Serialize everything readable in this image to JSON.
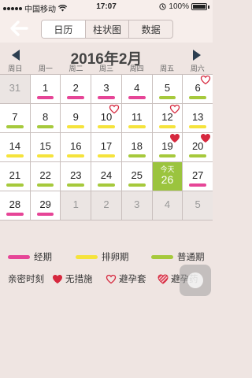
{
  "status": {
    "carrier": "中国移动",
    "time": "17:07",
    "battery": "100%"
  },
  "nav": {
    "tabs": [
      "日历",
      "柱状图",
      "数据"
    ],
    "active_tab": 0
  },
  "calendar": {
    "title": "2016年2月",
    "weekdays": [
      "周日",
      "周一",
      "周二",
      "周三",
      "周四",
      "周五",
      "周六"
    ],
    "today_label": "今天",
    "weeks": [
      [
        {
          "day": "31",
          "other": true
        },
        {
          "day": "1",
          "bar": "period"
        },
        {
          "day": "2",
          "bar": "period"
        },
        {
          "day": "3",
          "bar": "period"
        },
        {
          "day": "4",
          "bar": "period"
        },
        {
          "day": "5",
          "bar": "normal"
        },
        {
          "day": "6",
          "bar": "normal",
          "heart": "outline"
        }
      ],
      [
        {
          "day": "7",
          "bar": "normal"
        },
        {
          "day": "8",
          "bar": "normal"
        },
        {
          "day": "9",
          "bar": "ovulation"
        },
        {
          "day": "10",
          "bar": "ovulation",
          "heart": "outline"
        },
        {
          "day": "11",
          "bar": "ovulation"
        },
        {
          "day": "12",
          "bar": "ovulation",
          "heart": "outline"
        },
        {
          "day": "13",
          "bar": "ovulation"
        }
      ],
      [
        {
          "day": "14",
          "bar": "ovulation"
        },
        {
          "day": "15",
          "bar": "ovulation"
        },
        {
          "day": "16",
          "bar": "ovulation"
        },
        {
          "day": "17",
          "bar": "ovulation"
        },
        {
          "day": "18",
          "bar": "normal"
        },
        {
          "day": "19",
          "bar": "normal",
          "heart": "filled"
        },
        {
          "day": "20",
          "bar": "normal",
          "heart": "filled"
        }
      ],
      [
        {
          "day": "21",
          "bar": "normal"
        },
        {
          "day": "22",
          "bar": "normal"
        },
        {
          "day": "23",
          "bar": "normal"
        },
        {
          "day": "24",
          "bar": "normal"
        },
        {
          "day": "25",
          "bar": "normal"
        },
        {
          "day": "26",
          "today": true
        },
        {
          "day": "27",
          "bar": "period"
        }
      ],
      [
        {
          "day": "28",
          "bar": "period"
        },
        {
          "day": "29",
          "bar": "period"
        },
        {
          "day": "1",
          "other": true
        },
        {
          "day": "2",
          "other": true
        },
        {
          "day": "3",
          "other": true
        },
        {
          "day": "4",
          "other": true
        },
        {
          "day": "5",
          "other": true
        }
      ]
    ]
  },
  "legend": {
    "period": "经期",
    "ovulation": "排卵期",
    "normal": "普通期",
    "intimacy_label": "亲密时刻",
    "no_protection": "无措施",
    "condom": "避孕套",
    "pill": "避孕药"
  },
  "colors": {
    "period": "#e64597",
    "ovulation": "#f5e33c",
    "normal": "#a6c93c",
    "heart": "#d6283e",
    "today": "#9bc43e"
  }
}
